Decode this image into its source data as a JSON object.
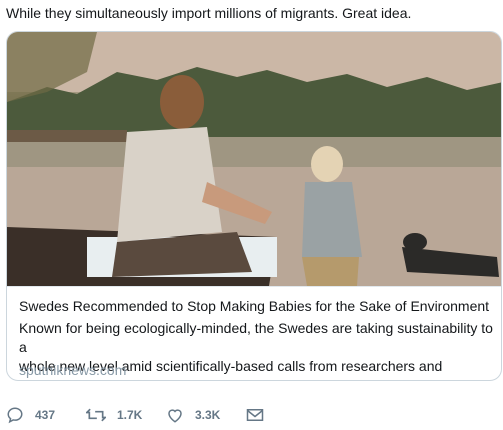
{
  "tweet": {
    "text": "While they simultaneously import millions of migrants. Great idea."
  },
  "card": {
    "title": "Swedes Recommended to Stop Making Babies for the Sake of Environment",
    "description_line1": "Known for being ecologically-minded, the Swedes are taking sustainability to a",
    "description_line2": "whole new level amid scientifically-based calls from researchers and environm...",
    "domain": "sputniknews.com"
  },
  "actions": {
    "replies": "437",
    "retweets": "1.7K",
    "likes": "3.3K"
  },
  "icons": {
    "reply": "reply-icon",
    "retweet": "retweet-icon",
    "like": "heart-icon",
    "message": "envelope-icon"
  },
  "colors": {
    "text": "#14171a",
    "muted": "#657786",
    "domain": "#8899a6",
    "border": "#ccd6dd"
  }
}
